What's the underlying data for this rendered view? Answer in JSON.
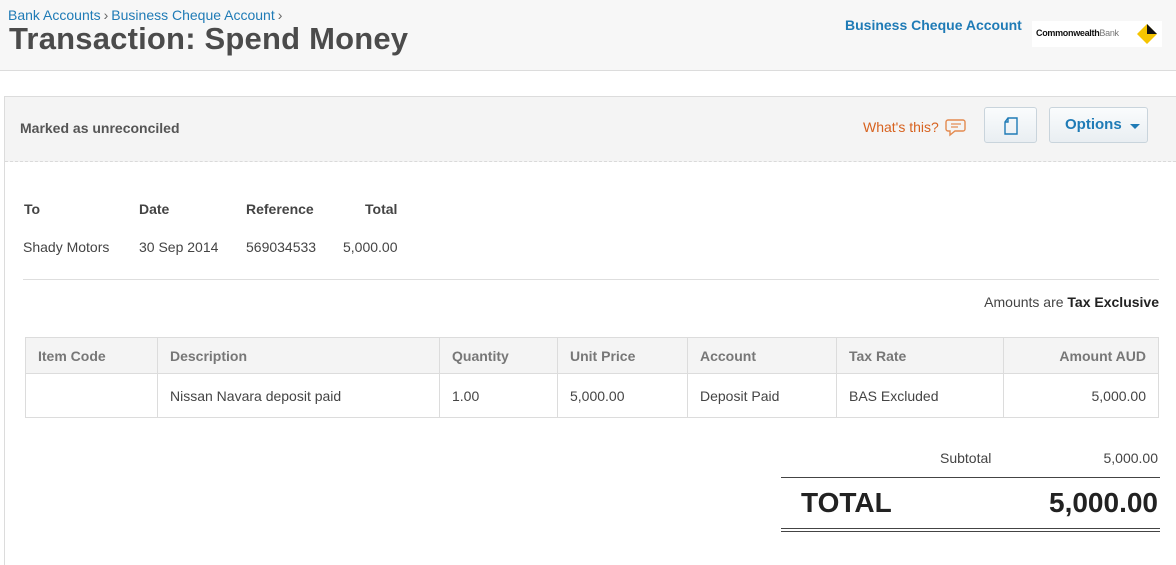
{
  "breadcrumb": {
    "items": [
      "Bank Accounts",
      "Business Cheque Account"
    ],
    "separator": "›"
  },
  "page_title": "Transaction: Spend Money",
  "account": {
    "name": "Business Cheque Account",
    "bank_logo_text_bold": "Commonwealth",
    "bank_logo_text_thin": "Bank"
  },
  "status_bar": {
    "status": "Marked as unreconciled",
    "whats_this": "What's this?",
    "options_label": "Options"
  },
  "summary": {
    "headers": {
      "to": "To",
      "date": "Date",
      "reference": "Reference",
      "total": "Total"
    },
    "values": {
      "to": "Shady Motors",
      "date": "30 Sep 2014",
      "reference": "569034533",
      "total": "5,000.00"
    }
  },
  "tax_note": {
    "prefix": "Amounts are",
    "mode": "Tax Exclusive"
  },
  "line_items": {
    "columns": [
      "Item Code",
      "Description",
      "Quantity",
      "Unit Price",
      "Account",
      "Tax Rate",
      "Amount AUD"
    ],
    "rows": [
      {
        "item_code": "",
        "description": "Nissan Navara deposit paid",
        "quantity": "1.00",
        "unit_price": "5,000.00",
        "account": "Deposit Paid",
        "tax_rate": "BAS Excluded",
        "amount": "5,000.00"
      }
    ]
  },
  "totals": {
    "subtotal_label": "Subtotal",
    "subtotal_value": "5,000.00",
    "total_label": "TOTAL",
    "total_value": "5,000.00"
  },
  "colors": {
    "link": "#1f7bb6",
    "whats_this": "#d7621f",
    "bank_diamond": "#f5c400"
  },
  "icons": {
    "help": "speech-bubble-icon",
    "attach": "document-icon",
    "options": "caret-down-icon",
    "bank": "diamond-icon"
  }
}
